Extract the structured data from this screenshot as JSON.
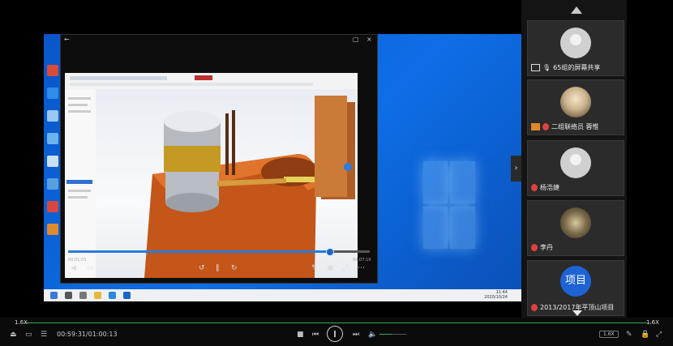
{
  "player": {
    "elapsed_small": "00:01:03",
    "total_small": "00:07:19"
  },
  "taskbar": {
    "time": "11:44",
    "date": "2020/10/24"
  },
  "participants": [
    {
      "name": "65组的屏幕共享",
      "kind": "screen-share"
    },
    {
      "name": "二组联络员 蓉惟",
      "kind": "photo"
    },
    {
      "name": "杨浩婕",
      "kind": "placeholder"
    },
    {
      "name": "李丹",
      "kind": "photo"
    },
    {
      "name": "2013/2017年平顶山项目",
      "kind": "badge",
      "badge_text": "项目"
    }
  ],
  "playback": {
    "position": "00:59:31/01:00:13",
    "speed_left": "1.6X",
    "speed_right": "1.6X",
    "speed_chip": "1.6X",
    "volume": 0.45,
    "progress": 0.99
  },
  "colors": {
    "accent": "#2fb14b",
    "blue": "#1e63d6"
  }
}
